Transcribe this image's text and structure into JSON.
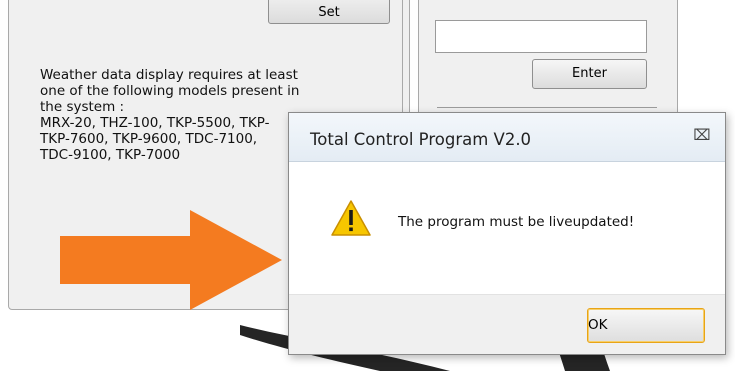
{
  "app": {
    "set_button_label": "Set",
    "enter_button_label": "Enter",
    "text_input_value": "",
    "info_text": "Weather data display requires at least\none of the following models present in\nthe system :\nMRX-20, THZ-100, TKP-5500, TKP-\nTKP-7600, TKP-9600, TDC-7100,\nTDC-9100, TKP-7000",
    "arrow_color": "#f47b20"
  },
  "dialog": {
    "title": "Total Control Program V2.0",
    "close_icon": "close-icon",
    "warning_icon": "warning-icon",
    "message": "The program must be liveupdated!",
    "ok_label": "OK",
    "accent_color": "#e8a416"
  }
}
